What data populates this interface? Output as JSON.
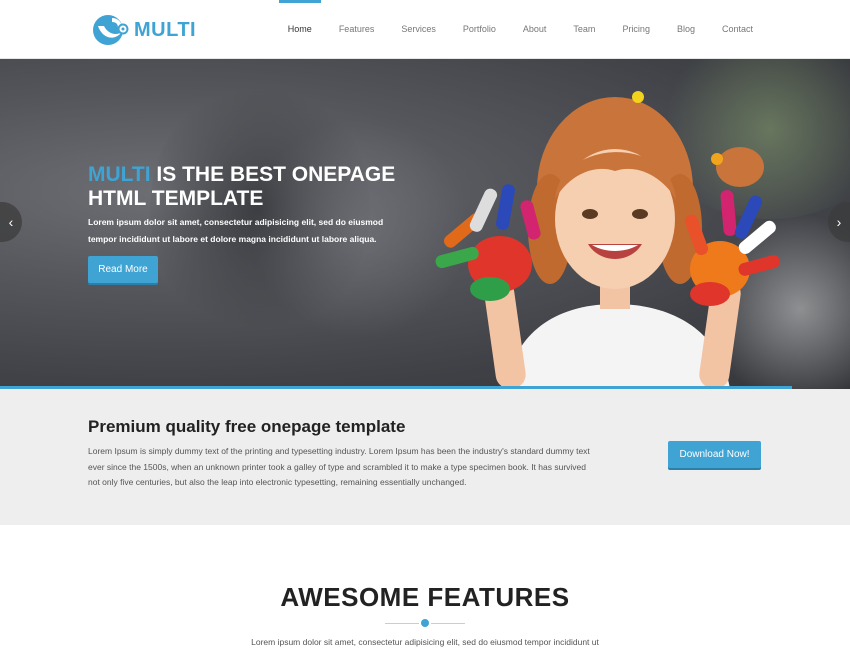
{
  "brand": {
    "name": "MULTI",
    "logo_icon": "bird-logo-icon",
    "accent_color": "#3fa3d3"
  },
  "nav": {
    "items": [
      {
        "label": "Home",
        "active": true
      },
      {
        "label": "Features",
        "active": false
      },
      {
        "label": "Services",
        "active": false
      },
      {
        "label": "Portfolio",
        "active": false
      },
      {
        "label": "About",
        "active": false
      },
      {
        "label": "Team",
        "active": false
      },
      {
        "label": "Pricing",
        "active": false
      },
      {
        "label": "Blog",
        "active": false
      },
      {
        "label": "Contact",
        "active": false
      }
    ]
  },
  "hero": {
    "title_accent": "MULTI",
    "title_rest": " IS THE BEST ONEPAGE HTML TEMPLATE",
    "text": "Lorem ipsum dolor sit amet, consectetur adipisicing elit, sed do eiusmod tempor incididunt ut labore et dolore magna incididunt ut labore aliqua.",
    "button": "Read More",
    "prev_icon": "‹",
    "next_icon": "›"
  },
  "promo": {
    "title": "Premium quality free onepage template",
    "text": "Lorem Ipsum is simply dummy text of the printing and typesetting industry. Lorem Ipsum has been the industry's standard dummy text ever since the 1500s, when an unknown printer took a galley of type and scrambled it to make a type specimen book. It has survived not only five centuries, but also the leap into electronic typesetting, remaining essentially unchanged.",
    "button": "Download Now!"
  },
  "features": {
    "title": "AWESOME FEATURES",
    "text": "Lorem ipsum dolor sit amet, consectetur adipisicing elit, sed do eiusmod tempor incididunt ut"
  }
}
